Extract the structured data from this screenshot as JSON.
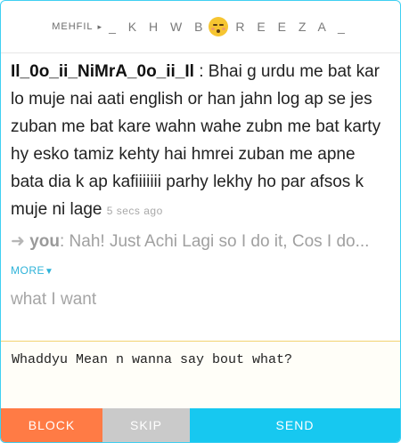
{
  "header": {
    "room_label": "MEHFIL",
    "arrow_glyph": "▸",
    "peer_name_left": "_ K H W B",
    "peer_name_right": "R E E Z A _",
    "emoji": "flushed-face-icon"
  },
  "messages": {
    "incoming": {
      "sender": "Il_0o_ii_NiMrA_0o_ii_Il",
      "separator": " : ",
      "text": "Bhai g urdu me bat kar lo muje nai aati english or han jahn log ap se jes zuban me bat kare wahn wahe zubn me bat karty hy esko tamiz kehty hai hmrei zuban me apne bata dia k ap kafiiiiiii parhy lekhy ho par afsos k muje ni lage",
      "timestamp": "5 secs ago"
    },
    "outgoing": {
      "arrow_glyph": "➜",
      "sender": "you",
      "separator": ": ",
      "text": "Nah! Just Achi Lagi so I do it, Cos I do...",
      "more_label": "MORE",
      "more_glyph": "▼",
      "continuation": "what I want"
    }
  },
  "compose": {
    "value": "Whaddyu Mean n wanna say bout what?"
  },
  "buttons": {
    "block": "BLOCK",
    "skip": "SKIP",
    "send": "SEND"
  },
  "colors": {
    "border": "#3fd0f2",
    "block": "#ff7b45",
    "skip": "#cacaca",
    "send": "#17c8f0",
    "link": "#2fb3d9"
  }
}
